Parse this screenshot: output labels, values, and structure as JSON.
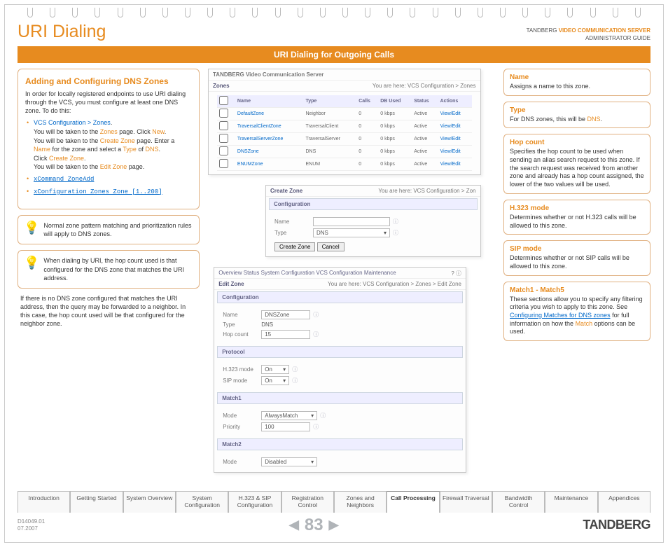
{
  "header": {
    "title": "URI Dialing",
    "brand_line": "TANDBERG",
    "product": "VIDEO COMMUNICATION SERVER",
    "subtitle": "ADMINISTRATOR GUIDE"
  },
  "ribbon": "URI Dialing for Outgoing Calls",
  "left": {
    "h": "Adding and Configuring DNS Zones",
    "intro": "In order for locally registered endpoints to use URI dialing through the VCS, you must configure at least one DNS zone.  To do this:",
    "steps": [
      {
        "line1": "VCS Configuration > Zones",
        "rest": "You will be taken to the ",
        "hl1": "Zones",
        "rest2": " page. Click ",
        "hl2": "New",
        "rest3": ".",
        "line2": "You will be taken to the ",
        "hl3": "Create Zone",
        "line2b": " page. Enter a ",
        "hl4": "Name",
        "line2c": " for the zone and select a ",
        "hl5": "Type",
        "line2d": " of ",
        "hl6": "DNS",
        "line2e": ".",
        "line3a": "Click ",
        "hl7": "Create Zone",
        "line3b": ".",
        "line4a": "You will be taken to the ",
        "hl8": "Edit Zone",
        "line4b": " page."
      }
    ],
    "cmd1": "xCommand ZoneAdd",
    "cmd2": "xConfiguration Zones Zone [1..200]",
    "tip1": "Normal zone pattern matching and prioritization rules will apply to DNS zones.",
    "tip2": "When dialing by URI, the hop count used is that configured for the DNS zone that matches the URI address.",
    "note": "If there is no DNS zone configured that matches the URI address, then the query may be forwarded to a neighbor.  In this case, the hop count used will be that configured for the neighbor zone."
  },
  "mid": {
    "zones_title": "Zones",
    "zones_youarehere": "You are here: VCS Configuration > Zones",
    "zones_brand": "TANDBERG Video Communication Server",
    "zones_cols": [
      "Name",
      "Type",
      "Calls",
      "DB Used",
      "Status",
      "Actions"
    ],
    "zones_rows": [
      [
        "DefaultZone",
        "Neighbor",
        "0",
        "0 kbps",
        "Active",
        "View/Edit"
      ],
      [
        "TraversalClientZone",
        "TraversalClient",
        "0",
        "0 kbps",
        "Active",
        "View/Edit"
      ],
      [
        "TraversalServerZone",
        "TraversalServer",
        "0",
        "0 kbps",
        "Active",
        "View/Edit"
      ],
      [
        "DNSZone",
        "DNS",
        "0",
        "0 kbps",
        "Active",
        "View/Edit"
      ],
      [
        "ENUMZone",
        "ENUM",
        "0",
        "0 kbps",
        "Active",
        "View/Edit"
      ]
    ],
    "create_title": "Create Zone",
    "create_youarehere": "You are here: VCS Configuration > Zon",
    "create_section": "Configuration",
    "create_name_label": "Name",
    "create_type_label": "Type",
    "create_type_value": "DNS",
    "btn_create": "Create Zone",
    "btn_cancel": "Cancel",
    "edit_nav": "Overview  Status  System Configuration  VCS Configuration  Maintenance",
    "edit_title": "Edit Zone",
    "edit_youarehere": "You are here: VCS Configuration > Zones > Edit Zone",
    "edit_sections": {
      "conf": "Configuration",
      "name_l": "Name",
      "name_v": "DNSZone",
      "type_l": "Type",
      "type_v": "DNS",
      "hop_l": "Hop count",
      "hop_v": "15",
      "proto": "Protocol",
      "h323_l": "H.323 mode",
      "h323_v": "On",
      "sip_l": "SIP mode",
      "sip_v": "On",
      "m1": "Match1",
      "mode_l": "Mode",
      "mode_v": "AlwaysMatch",
      "prio_l": "Priority",
      "prio_v": "100",
      "m2": "Match2",
      "mode2_l": "Mode",
      "mode2_v": "Disabled"
    }
  },
  "right": [
    {
      "h": "Name",
      "p": "Assigns a name to this zone."
    },
    {
      "h": "Type",
      "p_pre": "For DNS zones, this will be ",
      "hl": "DNS",
      "p_post": "."
    },
    {
      "h": "Hop count",
      "p": "Specifies the hop count to be used when sending an alias search request to this zone. If the search request was received from another zone and already has a hop count assigned, the lower of the two values will be used."
    },
    {
      "h": "H.323 mode",
      "p": "Determines whether or not H.323 calls will be allowed to this zone."
    },
    {
      "h": "SIP mode",
      "p": "Determines whether or not SIP calls will be allowed to this zone."
    },
    {
      "h": "Match1 - Match5",
      "p_pre": "These sections allow you to specify any filtering criteria you wish to apply to this zone. See ",
      "link": "Configuring Matches for DNS zones",
      "p_mid": " for full information on how the ",
      "hl": "Match",
      "p_post": " options can be used."
    }
  ],
  "tabs": [
    "Introduction",
    "Getting Started",
    "System Overview",
    "System Configuration",
    "H.323 & SIP Configuration",
    "Registration Control",
    "Zones and Neighbors",
    "Call Processing",
    "Firewall Traversal",
    "Bandwidth Control",
    "Maintenance",
    "Appendices"
  ],
  "active_tab_index": 7,
  "footer": {
    "doc": "D14049.01",
    "date": "07.2007",
    "page": "83",
    "brand": "TANDBERG"
  }
}
